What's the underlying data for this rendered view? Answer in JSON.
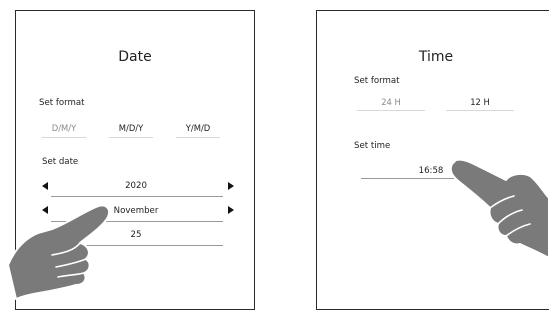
{
  "date_panel": {
    "title": "Date",
    "format_label": "Set format",
    "formats": [
      {
        "label": "D/M/Y",
        "selected": false
      },
      {
        "label": "M/D/Y",
        "selected": true
      },
      {
        "label": "Y/M/D",
        "selected": true
      }
    ],
    "set_label": "Set date",
    "year": "2020",
    "month": "November",
    "day": "25"
  },
  "time_panel": {
    "title": "Time",
    "format_label": "Set format",
    "formats": [
      {
        "label": "24 H",
        "selected": false
      },
      {
        "label": "12 H",
        "selected": true
      }
    ],
    "set_label": "Set time",
    "time": "16:58"
  },
  "icons": [
    "chevron-left-icon",
    "chevron-right-icon",
    "pointing-hand-icon"
  ],
  "colors": {
    "border": "#2a2a2a",
    "hand": "#7a7a7a",
    "muted_text": "#8a8a8a",
    "underline": "#d8d8d8"
  }
}
